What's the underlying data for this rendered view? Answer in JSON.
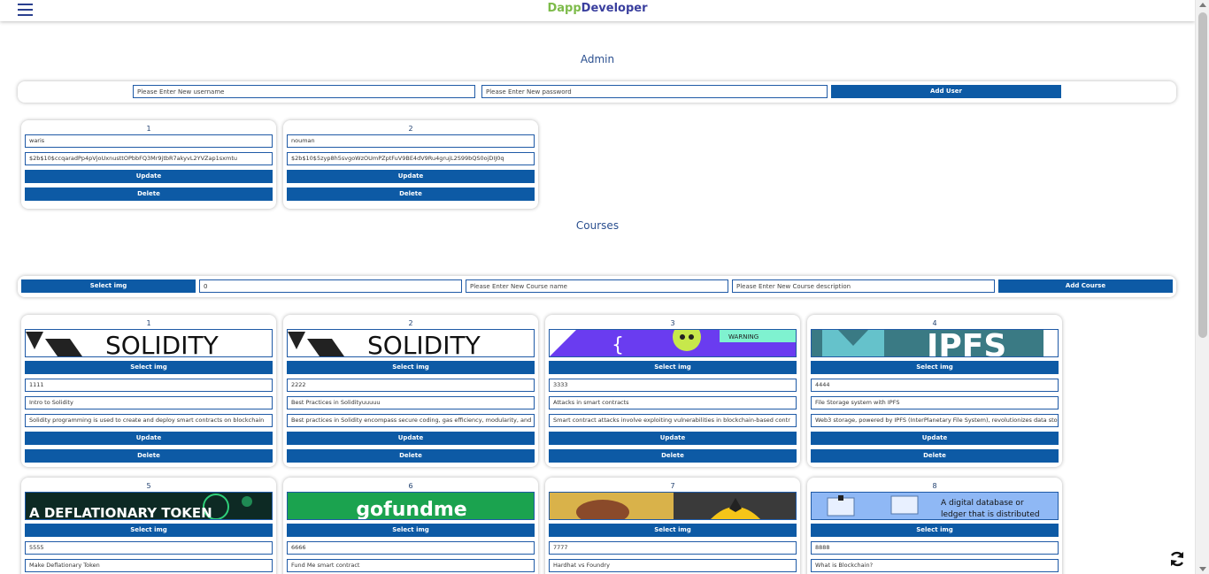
{
  "header": {
    "brand_part1": "Dapp",
    "brand_part2": "Developer",
    "menu_icon": "hamburger-menu-icon"
  },
  "admin": {
    "title": "Admin",
    "username_placeholder": "Please Enter New username",
    "password_placeholder": "Please Enter New password",
    "add_user_label": "Add User",
    "users": [
      {
        "num": "1",
        "username": "waris",
        "hash": "$2b$10$ccqaradPp4pVjoUxnusttOPbbFQ3Mr9jtbR7akyvL2YVZap1sxmtu",
        "update": "Update",
        "delete": "Delete"
      },
      {
        "num": "2",
        "username": "nouman",
        "hash": "$2b$10$5zyp8h5svgoWzOUmPZptFuV9BE4dV9Ru4grujL2S99bQS0ojDIJ0q",
        "update": "Update",
        "delete": "Delete"
      }
    ]
  },
  "courses": {
    "title": "Courses",
    "select_img_label": "Select img",
    "price_value": "0",
    "name_placeholder": "Please Enter New Course name",
    "description_placeholder": "Please Enter New Course description",
    "add_course_label": "Add Course",
    "items": [
      {
        "num": "1",
        "image": "SOLIDITY",
        "select": "Select img",
        "price": "1111",
        "name": "Intro to Solidity",
        "description": "Solidity programming is used to create and deploy smart contracts on blockchain",
        "update": "Update",
        "delete": "Delete"
      },
      {
        "num": "2",
        "image": "SOLIDITY",
        "select": "Select img",
        "price": "2222",
        "name": "Best Practices in Solidityuuuuu",
        "description": "Best practices in Solidity encompass secure coding, gas efficiency, modularity, and",
        "update": "Update",
        "delete": "Delete"
      },
      {
        "num": "3",
        "image": "WARNING",
        "select": "Select img",
        "price": "3333",
        "name": "Attacks in smart contracts",
        "description": "Smart contract attacks involve exploiting vulnerabilities in blockchain-based contr",
        "update": "Update",
        "delete": "Delete"
      },
      {
        "num": "4",
        "image": "IPFS",
        "select": "Select img",
        "price": "4444",
        "name": "File Storage system with IPFS",
        "description": "Web3 storage, powered by IPFS (InterPlanetary File System), revolutionizes data sto",
        "update": "Update",
        "delete": "Delete"
      },
      {
        "num": "5",
        "image": "A DEFLATIONARY TOKEN",
        "select": "Select img",
        "price": "5555",
        "name": "Make Deflationary Token"
      },
      {
        "num": "6",
        "image": "gofundme",
        "select": "Select img",
        "price": "6666",
        "name": "Fund Me smart contract"
      },
      {
        "num": "7",
        "image": "",
        "select": "Select img",
        "price": "7777",
        "name": "Hardhat vs Foundry"
      },
      {
        "num": "8",
        "image": "A digital database or ledger that is distributed",
        "select": "Select img",
        "price": "8888",
        "name": "What is Blockchain?"
      }
    ]
  },
  "colors": {
    "primary": "#0d5aa5",
    "brand_green": "#7dbb4a",
    "brand_blue": "#3a3f9e"
  }
}
